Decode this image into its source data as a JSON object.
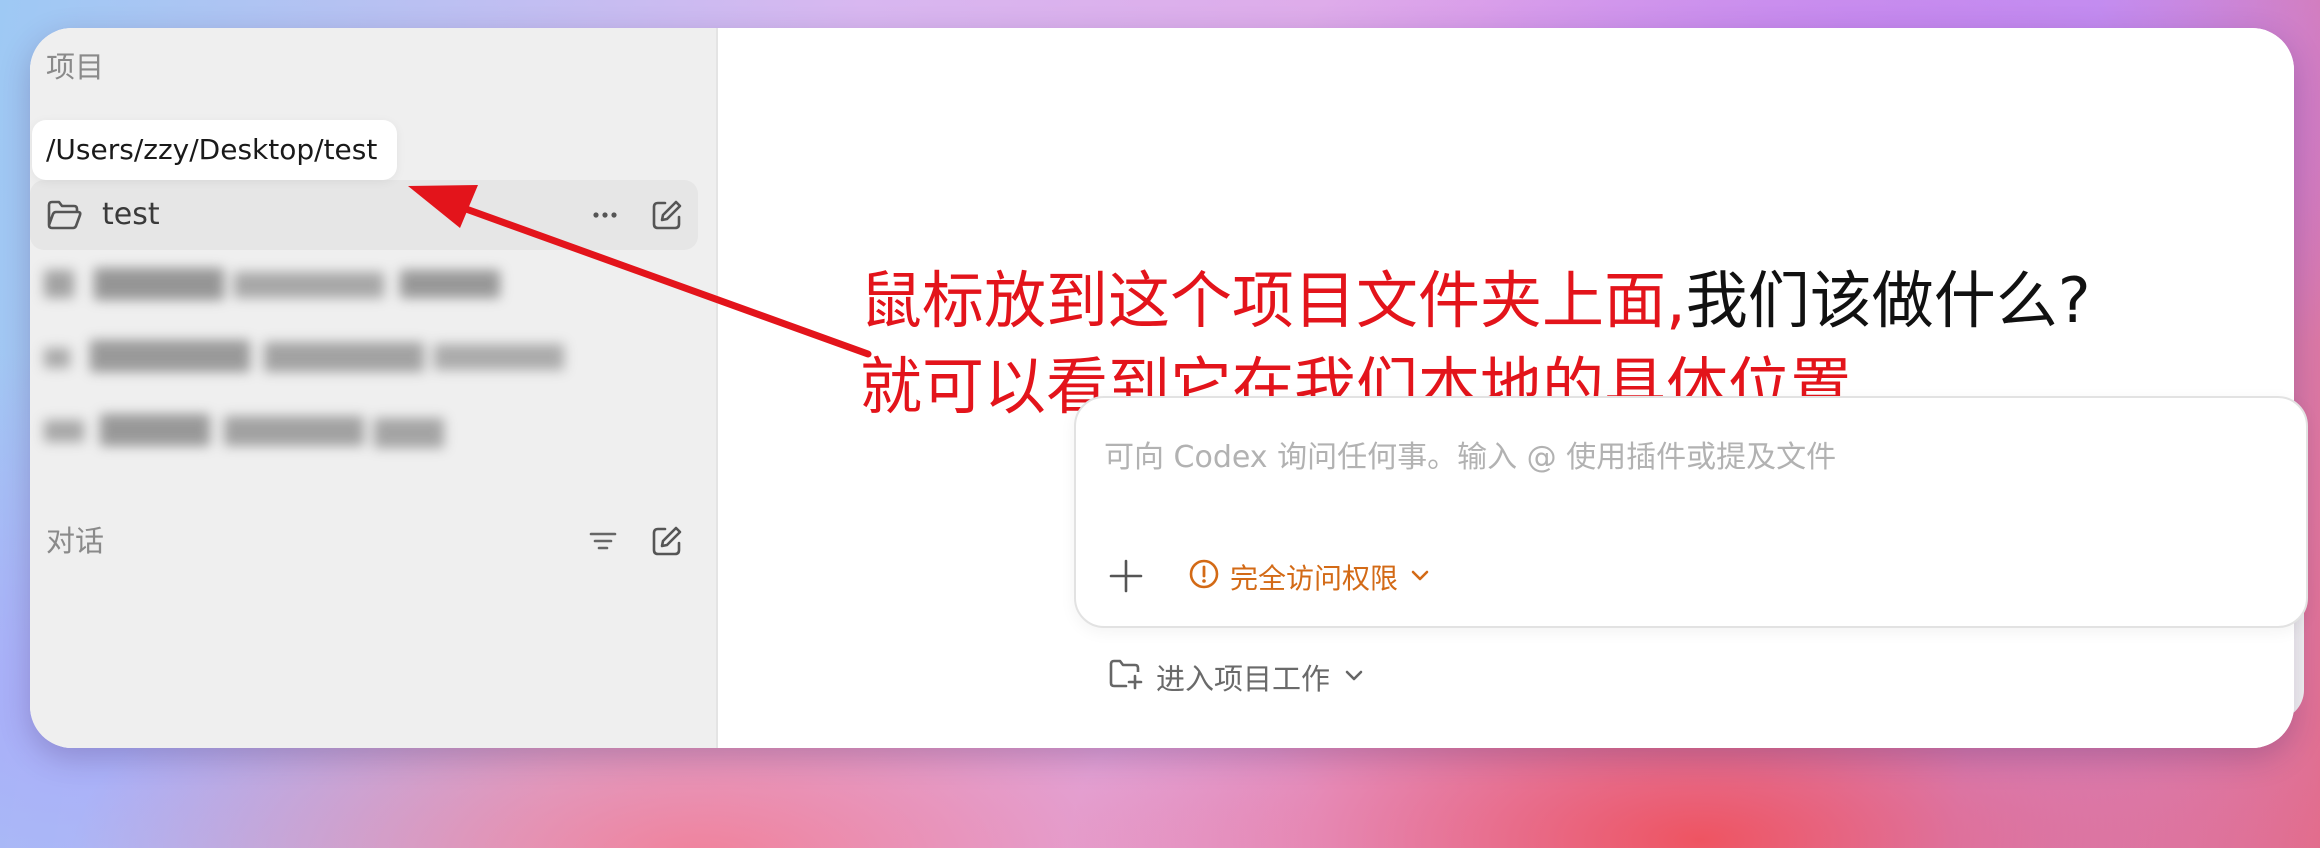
{
  "sidebar": {
    "projects_label": "项目",
    "tooltip_path": "/Users/zzy/Desktop/test",
    "project": {
      "name": "test",
      "more_icon": "ellipsis-icon",
      "new_icon": "compose-icon"
    },
    "conversations_label": "对话"
  },
  "annotation": {
    "line1_red": "鼠标放到这个项目文件夹上面,",
    "line1_black": "我们该做什么?",
    "line2_red": "就可以看到它在我们本地的具体位置",
    "color_red": "#e3141b"
  },
  "composer": {
    "placeholder": "可向 Codex 询问任何事。输入 @ 使用插件或提及文件",
    "access_label": "完全访问权限",
    "access_color": "#d36a16"
  },
  "footer": {
    "work_label": "进入项目工作"
  }
}
